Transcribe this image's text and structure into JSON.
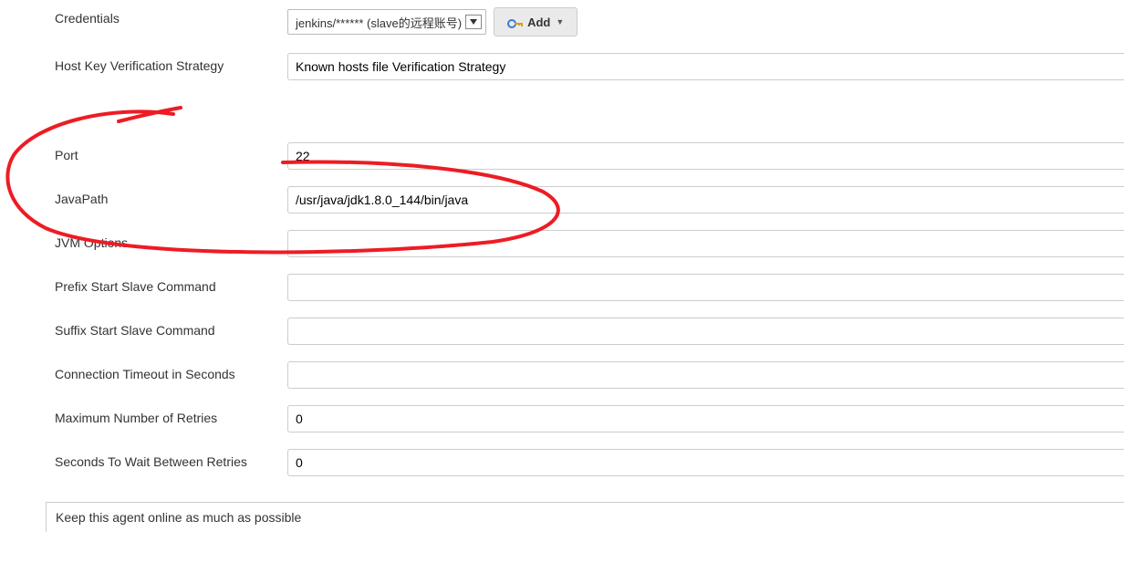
{
  "labels": {
    "credentials": "Credentials",
    "hostKey": "Host Key Verification Strategy",
    "port": "Port",
    "javaPath": "JavaPath",
    "jvmOptions": "JVM Options",
    "prefixCmd": "Prefix Start Slave Command",
    "suffixCmd": "Suffix Start Slave Command",
    "connTimeout": "Connection Timeout in Seconds",
    "maxRetries": "Maximum Number of Retries",
    "waitRetries": "Seconds To Wait Between Retries"
  },
  "values": {
    "credentials": "jenkins/****** (slave的远程账号)",
    "hostKey": "Known hosts file Verification Strategy",
    "port": "22",
    "javaPath": "/usr/java/jdk1.8.0_144/bin/java",
    "jvmOptions": "",
    "prefixCmd": "",
    "suffixCmd": "",
    "connTimeout": "",
    "maxRetries": "0",
    "waitRetries": "0"
  },
  "addBtn": "Add",
  "availability": "Keep this agent online as much as possible"
}
